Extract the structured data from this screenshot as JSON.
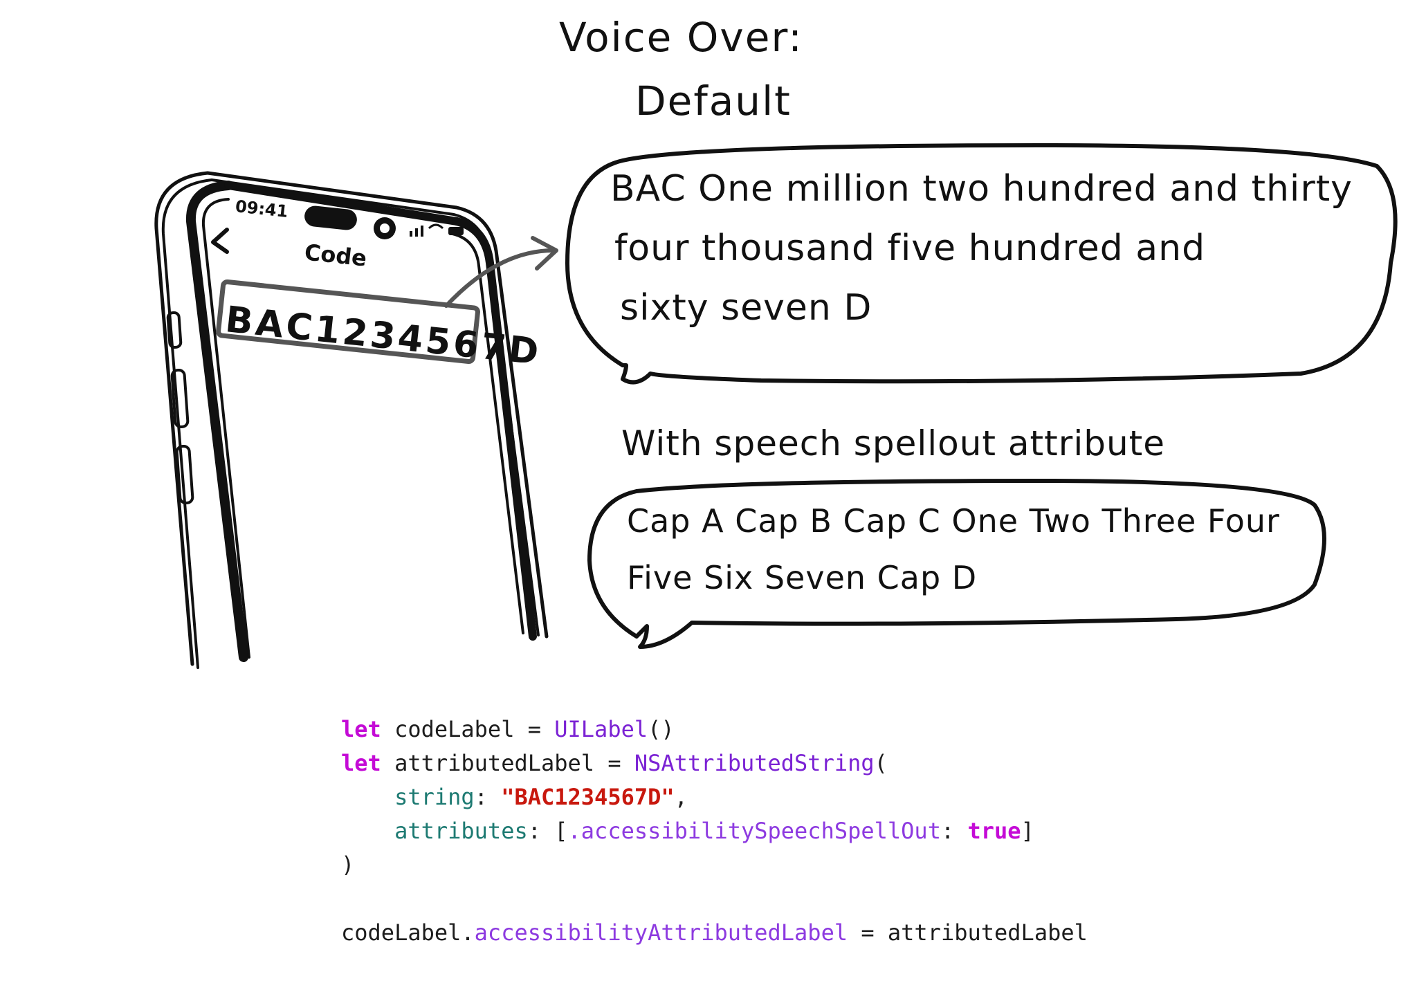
{
  "header": {
    "title": "Voice Over:",
    "subtitle": "Default"
  },
  "phone": {
    "time": "09:41",
    "nav_title": "Code",
    "field_value": "BAC1234567D"
  },
  "default_bubble": {
    "lines": [
      "BAC One million two hundred and thirty",
      "four thousand five hundred and",
      "sixty seven D"
    ]
  },
  "spellout": {
    "heading": "With speech spellout attribute",
    "lines": [
      "Cap A Cap B Cap C One Two Three Four",
      "Five Six Seven Cap D"
    ]
  },
  "code": {
    "let1": "let",
    "var1": "codeLabel",
    "eq": "=",
    "type1": "UILabel",
    "parens": "()",
    "let2": "let",
    "var2": "attributedLabel",
    "type2": "NSAttributedString",
    "open": "(",
    "param_string": "string",
    "string_value": "\"BAC1234567D\"",
    "param_attributes": "attributes",
    "attr_key": ".accessibilitySpeechSpellOut",
    "attr_value": "true",
    "close": ")",
    "target": "codeLabel",
    "property": "accessibilityAttributedLabel",
    "rhs": "attributedLabel"
  },
  "colors": {
    "keyword": "#c40bd6",
    "type": "#7b22d4",
    "parameter": "#1d7a72",
    "string": "#c8180e",
    "property": "#8d3ae0"
  }
}
